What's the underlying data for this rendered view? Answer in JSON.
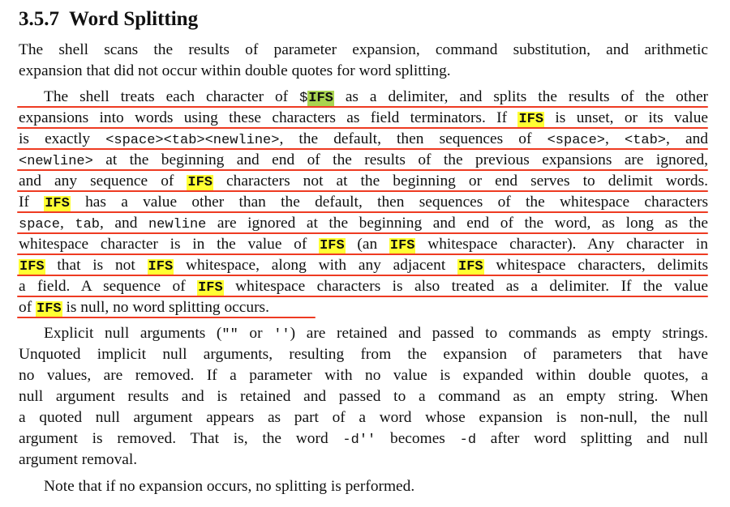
{
  "heading": {
    "number": "3.5.7",
    "title": "Word Splitting"
  },
  "lines": [
    "The shell scans the results of parameter expansion, command substitution, and arithmetic",
    "expansion that did not occur within double quotes for word splitting."
  ],
  "para2": {
    "l1": [
      "The shell treats each character of ",
      "$",
      "IFS",
      " as a delimiter, and splits the results of the other"
    ],
    "l2": [
      "expansions into words using these characters as field terminators.  If ",
      "IFS",
      " is unset, or its value"
    ],
    "l3": [
      "is exactly ",
      "<space><tab><newline>",
      ", the default, then sequences of  ",
      "<space>",
      ", ",
      "<tab>",
      ", and"
    ],
    "l4": [
      "<newline>",
      " at the beginning and end of the results of the previous expansions are ignored,"
    ],
    "l5": [
      "and any sequence of ",
      "IFS",
      " characters not at the beginning or end serves to delimit words."
    ],
    "l6": [
      "If ",
      "IFS",
      " has a value other than the default, then sequences of the whitespace characters"
    ],
    "l7": [
      "space",
      ", ",
      "tab",
      ", and ",
      "newline",
      " are ignored at the beginning and end of the word, as long as the"
    ],
    "l8": [
      "whitespace character is in the value of ",
      "IFS",
      " (an ",
      "IFS",
      " whitespace character).  Any character in"
    ],
    "l9": [
      "IFS",
      " that is not ",
      "IFS",
      " whitespace, along with any adjacent ",
      "IFS",
      " whitespace characters, delimits"
    ],
    "l10": [
      "a field.  A sequence of ",
      "IFS",
      " whitespace characters is also treated as a delimiter.  If the value"
    ],
    "l11": [
      "of ",
      "IFS",
      " is null, no word splitting occurs."
    ]
  },
  "para3": {
    "l1": [
      "Explicit null arguments (",
      "\"\"",
      " or ",
      "''",
      ") are retained and passed to commands as empty strings."
    ],
    "l2": "Unquoted implicit null arguments, resulting from the expansion of parameters that have",
    "l3": "no values, are removed.  If a parameter with no value is expanded within double quotes, a",
    "l4": "null argument results and is retained and passed to a command as an empty string.  When",
    "l5": "a quoted null argument appears as part of a word whose expansion is non-null, the null",
    "l6": [
      "argument is removed.  That is, the word ",
      "-d''",
      " becomes ",
      "-d",
      " after word splitting and null"
    ],
    "l7": "argument removal."
  },
  "para4": "Note that if no expansion occurs, no splitting is performed.",
  "colors": {
    "highlight_yellow": "#ffff33",
    "highlight_green": "#a9d450",
    "underline_red": "#ee3b22"
  }
}
